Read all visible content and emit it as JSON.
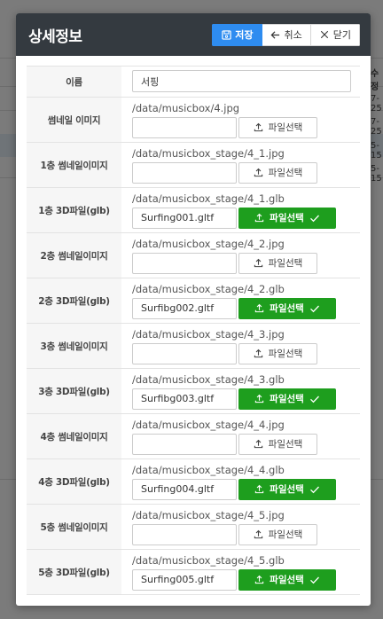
{
  "background": {
    "col_header": "수정",
    "rows": [
      "7-25",
      "7-25",
      "5-15",
      "5-15"
    ]
  },
  "modal": {
    "title": "상세정보",
    "buttons": {
      "save": "저장",
      "cancel": "취소",
      "close": "닫기"
    },
    "name_label": "이름",
    "name_value": "서핑",
    "file_button_label": "파일선택",
    "colors": {
      "header_bg": "#343a40",
      "save_bg": "#2e8cf0",
      "uploaded_bg": "#1e9e1e"
    },
    "rows": [
      {
        "label": "썸네일 이미지",
        "path": "/data/musicbox/4.jpg",
        "file": "",
        "uploaded": false
      },
      {
        "label": "1층 썸네일이미지",
        "path": "/data/musicbox_stage/4_1.jpg",
        "file": "",
        "uploaded": false
      },
      {
        "label": "1층 3D파일(glb)",
        "path": "/data/musicbox_stage/4_1.glb",
        "file": "Surfing001.gltf",
        "uploaded": true
      },
      {
        "label": "2층 썸네일이미지",
        "path": "/data/musicbox_stage/4_2.jpg",
        "file": "",
        "uploaded": false
      },
      {
        "label": "2층 3D파일(glb)",
        "path": "/data/musicbox_stage/4_2.glb",
        "file": "Surfibg002.gltf",
        "uploaded": true
      },
      {
        "label": "3층 썸네일이미지",
        "path": "/data/musicbox_stage/4_3.jpg",
        "file": "",
        "uploaded": false
      },
      {
        "label": "3층 3D파일(glb)",
        "path": "/data/musicbox_stage/4_3.glb",
        "file": "Surfibg003.gltf",
        "uploaded": true
      },
      {
        "label": "4층 썸네일이미지",
        "path": "/data/musicbox_stage/4_4.jpg",
        "file": "",
        "uploaded": false
      },
      {
        "label": "4층 3D파일(glb)",
        "path": "/data/musicbox_stage/4_4.glb",
        "file": "Surfing004.gltf",
        "uploaded": true
      },
      {
        "label": "5층 썸네일이미지",
        "path": "/data/musicbox_stage/4_5.jpg",
        "file": "",
        "uploaded": false
      },
      {
        "label": "5층 3D파일(glb)",
        "path": "/data/musicbox_stage/4_5.glb",
        "file": "Surfing005.gltf",
        "uploaded": true
      }
    ]
  }
}
